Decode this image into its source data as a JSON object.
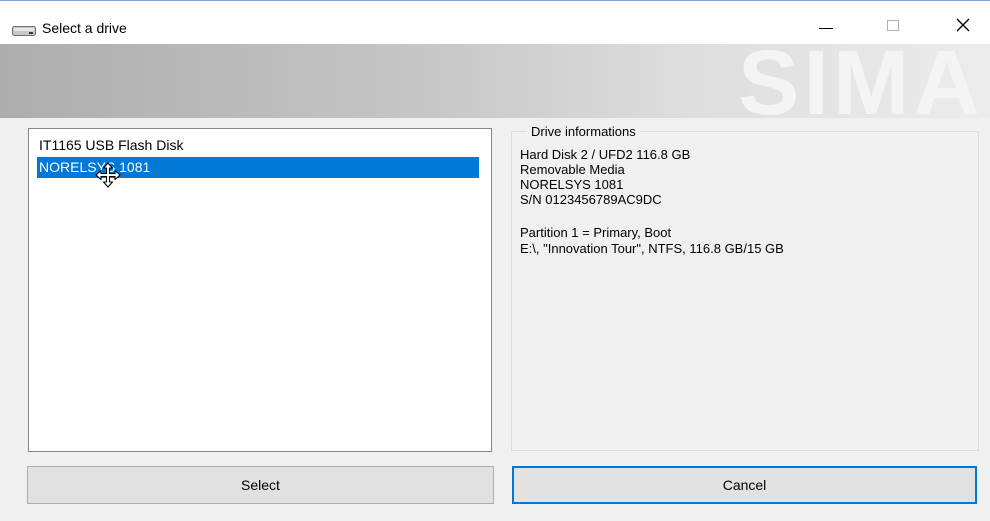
{
  "window": {
    "title": "Select a drive",
    "icons": {
      "app": "drive-icon",
      "minimize": "minimize-icon",
      "maximize": "maximize-icon",
      "close": "close-icon"
    }
  },
  "banner": {
    "logo_text": "SIMA"
  },
  "drive_list": {
    "items": [
      {
        "label": "IT1165 USB Flash Disk",
        "selected": false
      },
      {
        "label": "NORELSYS 1081",
        "selected": true
      }
    ],
    "selection_color": "#0078d7"
  },
  "drive_info": {
    "legend": "Drive informations",
    "lines": [
      "Hard Disk 2 / UFD2 116.8 GB",
      "Removable Media",
      "NORELSYS 1081",
      "S/N 0123456789AC9DC",
      "Partition 1 = Primary, Boot",
      "E:\\, \"Innovation Tour\", NTFS, 116.8 GB/15 GB"
    ]
  },
  "buttons": {
    "select_label": "Select",
    "cancel_label": "Cancel"
  },
  "cursor": {
    "icon": "move-cursor-icon"
  }
}
